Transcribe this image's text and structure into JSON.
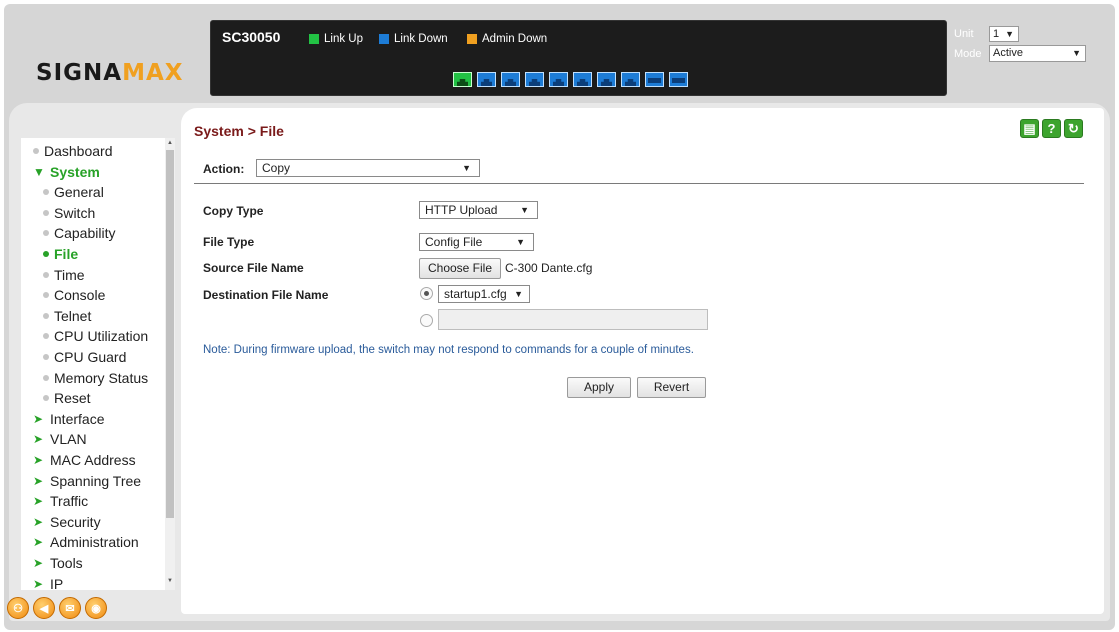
{
  "header": {
    "logo_main": "SIGNA",
    "logo_accent": "MAX",
    "model": "SC30050",
    "legend": {
      "link_up": "Link Up",
      "link_down": "Link Down",
      "admin_down": "Admin Down"
    },
    "colors": {
      "link_up": "#22c244",
      "link_down": "#1d7cd6",
      "admin_down": "#f0a020"
    },
    "ports": [
      "up",
      "down",
      "down",
      "down",
      "down",
      "down",
      "down",
      "down",
      "sfp",
      "sfp"
    ],
    "unit_label": "Unit",
    "unit_value": "1",
    "mode_label": "Mode",
    "mode_value": "Active"
  },
  "sidebar": {
    "items": [
      {
        "label": "Dashboard",
        "kind": "dot"
      },
      {
        "label": "System",
        "kind": "open"
      },
      {
        "label": "General",
        "kind": "sub"
      },
      {
        "label": "Switch",
        "kind": "sub"
      },
      {
        "label": "Capability",
        "kind": "sub"
      },
      {
        "label": "File",
        "kind": "sub-active"
      },
      {
        "label": "Time",
        "kind": "sub"
      },
      {
        "label": "Console",
        "kind": "sub"
      },
      {
        "label": "Telnet",
        "kind": "sub"
      },
      {
        "label": "CPU Utilization",
        "kind": "sub"
      },
      {
        "label": "CPU Guard",
        "kind": "sub"
      },
      {
        "label": "Memory Status",
        "kind": "sub"
      },
      {
        "label": "Reset",
        "kind": "sub"
      },
      {
        "label": "Interface",
        "kind": "closed"
      },
      {
        "label": "VLAN",
        "kind": "closed"
      },
      {
        "label": "MAC Address",
        "kind": "closed"
      },
      {
        "label": "Spanning Tree",
        "kind": "closed"
      },
      {
        "label": "Traffic",
        "kind": "closed"
      },
      {
        "label": "Security",
        "kind": "closed"
      },
      {
        "label": "Administration",
        "kind": "closed"
      },
      {
        "label": "Tools",
        "kind": "closed"
      },
      {
        "label": "IP",
        "kind": "closed"
      }
    ]
  },
  "footer_icons": [
    "network-icon",
    "back-icon",
    "mail-icon",
    "globe-icon"
  ],
  "page": {
    "title": "System > File",
    "action_label": "Action:",
    "action_value": "Copy",
    "copy_type_label": "Copy Type",
    "copy_type_value": "HTTP Upload",
    "file_type_label": "File Type",
    "file_type_value": "Config File",
    "source_label": "Source File Name",
    "choose_file": "Choose File",
    "chosen_file": "C-300 Dante.cfg",
    "dest_label": "Destination File Name",
    "dest_value": "startup1.cfg",
    "dest_custom": "",
    "note": "Note: During firmware upload, the switch may not respond to commands for a couple of minutes.",
    "apply": "Apply",
    "revert": "Revert"
  }
}
